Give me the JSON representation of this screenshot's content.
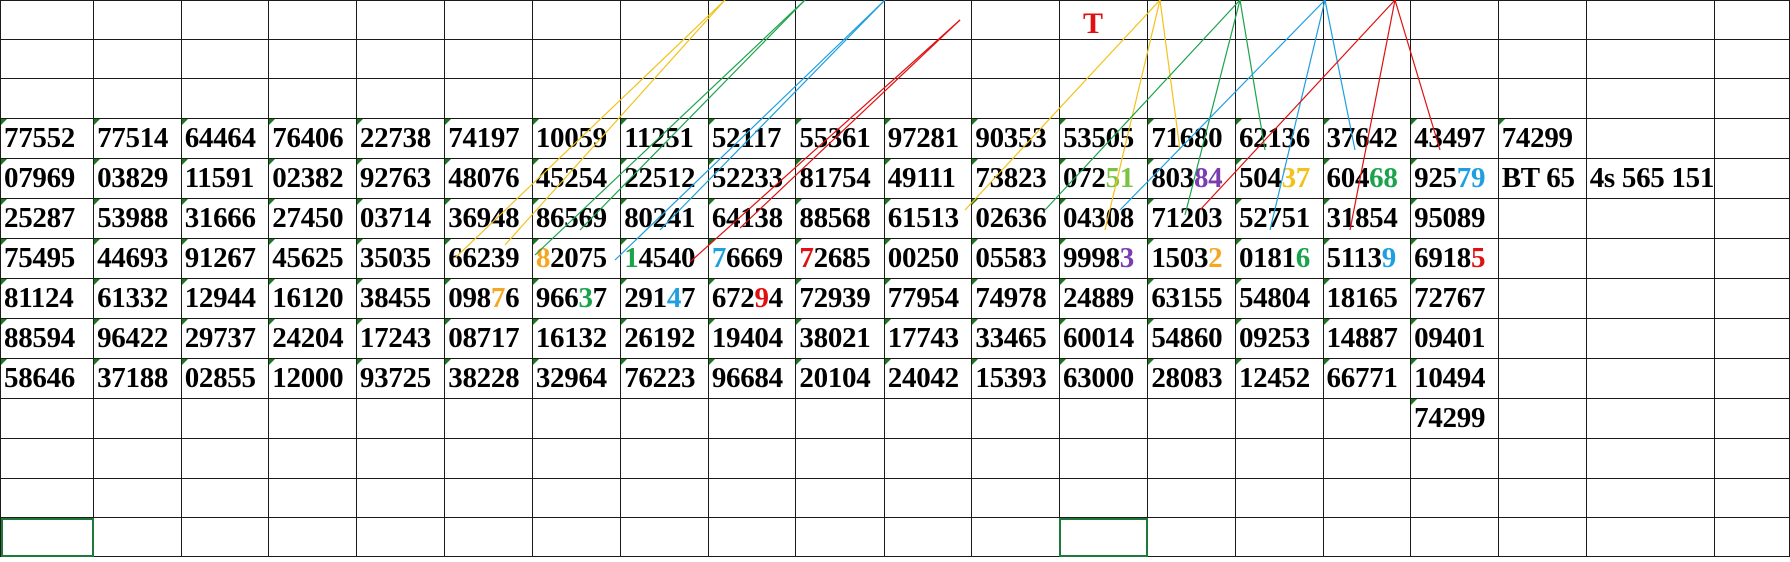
{
  "colors": {
    "red": "#e01010",
    "orange": "#f5a623",
    "green": "#1aa34a",
    "blue": "#1e9fe0",
    "purple": "#7a3db0",
    "lightgreen": "#7cc242",
    "yellow": "#f2c21b"
  },
  "annotations": {
    "t_label": "T"
  },
  "rows": [
    [
      {
        "t": ""
      },
      {
        "t": ""
      },
      {
        "t": ""
      },
      {
        "t": ""
      },
      {
        "t": ""
      },
      {
        "t": ""
      },
      {
        "t": ""
      },
      {
        "t": ""
      },
      {
        "t": ""
      },
      {
        "t": ""
      },
      {
        "t": ""
      },
      {
        "t": ""
      },
      {
        "t": ""
      },
      {
        "t": ""
      },
      {
        "t": ""
      },
      {
        "t": ""
      },
      {
        "t": ""
      },
      {
        "t": ""
      },
      {
        "t": ""
      },
      {
        "t": ""
      }
    ],
    [
      {
        "t": ""
      },
      {
        "t": ""
      },
      {
        "t": ""
      },
      {
        "t": ""
      },
      {
        "t": ""
      },
      {
        "t": ""
      },
      {
        "t": ""
      },
      {
        "t": ""
      },
      {
        "t": ""
      },
      {
        "t": ""
      },
      {
        "t": ""
      },
      {
        "t": ""
      },
      {
        "t": ""
      },
      {
        "t": ""
      },
      {
        "t": ""
      },
      {
        "t": ""
      },
      {
        "t": ""
      },
      {
        "t": ""
      },
      {
        "t": ""
      },
      {
        "t": ""
      }
    ],
    [
      {
        "t": ""
      },
      {
        "t": ""
      },
      {
        "t": ""
      },
      {
        "t": ""
      },
      {
        "t": ""
      },
      {
        "t": ""
      },
      {
        "t": ""
      },
      {
        "t": ""
      },
      {
        "t": ""
      },
      {
        "t": ""
      },
      {
        "t": ""
      },
      {
        "t": ""
      },
      {
        "t": ""
      },
      {
        "t": ""
      },
      {
        "t": ""
      },
      {
        "t": ""
      },
      {
        "t": ""
      },
      {
        "t": ""
      },
      {
        "t": ""
      },
      {
        "t": ""
      }
    ],
    [
      {
        "t": "77552"
      },
      {
        "t": "77514"
      },
      {
        "t": "64464"
      },
      {
        "t": "76406"
      },
      {
        "t": "22738"
      },
      {
        "t": "74197"
      },
      {
        "t": "10059"
      },
      {
        "t": "11251"
      },
      {
        "t": "52117"
      },
      {
        "t": "55361"
      },
      {
        "t": "97281"
      },
      {
        "t": "90353"
      },
      {
        "t": "53505"
      },
      {
        "t": "71680"
      },
      {
        "t": "62136"
      },
      {
        "t": "37642"
      },
      {
        "t": "43497"
      },
      {
        "t": "74299"
      },
      {
        "t": ""
      },
      {
        "t": ""
      }
    ],
    [
      {
        "t": "07969"
      },
      {
        "t": "03829"
      },
      {
        "t": "11591"
      },
      {
        "t": "02382"
      },
      {
        "t": "92763"
      },
      {
        "t": "48076"
      },
      {
        "t": "45254"
      },
      {
        "t": "22512"
      },
      {
        "t": "52233"
      },
      {
        "t": "81754"
      },
      {
        "t": "49111"
      },
      {
        "t": "73823"
      },
      {
        "t": "072",
        "h": "51",
        "c": "lightgreen"
      },
      {
        "t": "803",
        "h": "84",
        "c": "purple"
      },
      {
        "t": "504",
        "h": "37",
        "c": "yellow"
      },
      {
        "t": "604",
        "h": "68",
        "c": "green"
      },
      {
        "t": "925",
        "h": "79",
        "c": "blue"
      },
      {
        "t": "BT 65",
        "red": true
      },
      {
        "t": "4s 565 151",
        "red": true
      },
      {
        "t": ""
      }
    ],
    [
      {
        "t": "25287"
      },
      {
        "t": "53988"
      },
      {
        "t": "31666"
      },
      {
        "t": "27450"
      },
      {
        "t": "03714"
      },
      {
        "t": "36948"
      },
      {
        "t": "86569"
      },
      {
        "t": "80241"
      },
      {
        "t": "64138"
      },
      {
        "t": "88568"
      },
      {
        "t": "61513"
      },
      {
        "t": "02636"
      },
      {
        "t": "04308"
      },
      {
        "t": "71203"
      },
      {
        "t": "52751"
      },
      {
        "t": "31854"
      },
      {
        "t": "95089"
      },
      {
        "t": ""
      },
      {
        "t": ""
      },
      {
        "t": ""
      }
    ],
    [
      {
        "t": "75495"
      },
      {
        "t": "44693"
      },
      {
        "t": "91267"
      },
      {
        "t": "45625"
      },
      {
        "t": "35035"
      },
      {
        "t": "66239"
      },
      {
        "t": "",
        "h": "8",
        "c": "orange",
        "s": "2075"
      },
      {
        "t": "",
        "h": "1",
        "c": "green",
        "s": "4540"
      },
      {
        "t": "",
        "h": "7",
        "c": "blue",
        "s": "6669"
      },
      {
        "t": "",
        "h": "7",
        "c": "red",
        "s": "2685"
      },
      {
        "t": "00250"
      },
      {
        "t": "05583"
      },
      {
        "t": "9998",
        "h": "3",
        "c": "purple"
      },
      {
        "t": "1503",
        "h": "2",
        "c": "orange"
      },
      {
        "t": "0181",
        "h": "6",
        "c": "green"
      },
      {
        "t": "5113",
        "h": "9",
        "c": "blue"
      },
      {
        "t": "6918",
        "h": "5",
        "c": "red"
      },
      {
        "t": ""
      },
      {
        "t": ""
      },
      {
        "t": ""
      }
    ],
    [
      {
        "t": "81124"
      },
      {
        "t": "61332"
      },
      {
        "t": "12944"
      },
      {
        "t": "16120"
      },
      {
        "t": "38455"
      },
      {
        "t": "098",
        "h": "7",
        "c": "orange",
        "s": "6"
      },
      {
        "t": "966",
        "h": "3",
        "c": "green",
        "s": "7"
      },
      {
        "t": "291",
        "h": "4",
        "c": "blue",
        "s": "7"
      },
      {
        "t": "672",
        "h": "9",
        "c": "red",
        "s": "4"
      },
      {
        "t": "72939"
      },
      {
        "t": "77954"
      },
      {
        "t": "74978"
      },
      {
        "t": "24889"
      },
      {
        "t": "63155"
      },
      {
        "t": "54804"
      },
      {
        "t": "18165"
      },
      {
        "t": "72767"
      },
      {
        "t": ""
      },
      {
        "t": ""
      },
      {
        "t": ""
      }
    ],
    [
      {
        "t": "88594"
      },
      {
        "t": "96422"
      },
      {
        "t": "29737"
      },
      {
        "t": "24204"
      },
      {
        "t": "17243"
      },
      {
        "t": "08717"
      },
      {
        "t": "16132"
      },
      {
        "t": "26192"
      },
      {
        "t": "19404"
      },
      {
        "t": "38021"
      },
      {
        "t": "17743"
      },
      {
        "t": "33465"
      },
      {
        "t": "60014"
      },
      {
        "t": "54860"
      },
      {
        "t": "09253"
      },
      {
        "t": "14887"
      },
      {
        "t": "09401"
      },
      {
        "t": ""
      },
      {
        "t": ""
      },
      {
        "t": ""
      }
    ],
    [
      {
        "t": "58646"
      },
      {
        "t": "37188"
      },
      {
        "t": "02855"
      },
      {
        "t": "12000"
      },
      {
        "t": "93725"
      },
      {
        "t": "38228"
      },
      {
        "t": "32964"
      },
      {
        "t": "76223"
      },
      {
        "t": "96684"
      },
      {
        "t": "20104"
      },
      {
        "t": "24042"
      },
      {
        "t": "15393"
      },
      {
        "t": "63000"
      },
      {
        "t": "28083"
      },
      {
        "t": "12452"
      },
      {
        "t": "66771"
      },
      {
        "t": "10494"
      },
      {
        "t": ""
      },
      {
        "t": ""
      },
      {
        "t": ""
      }
    ],
    [
      {
        "t": ""
      },
      {
        "t": ""
      },
      {
        "t": ""
      },
      {
        "t": ""
      },
      {
        "t": ""
      },
      {
        "t": ""
      },
      {
        "t": ""
      },
      {
        "t": ""
      },
      {
        "t": ""
      },
      {
        "t": ""
      },
      {
        "t": ""
      },
      {
        "t": ""
      },
      {
        "t": ""
      },
      {
        "t": ""
      },
      {
        "t": ""
      },
      {
        "t": ""
      },
      {
        "t": "74299"
      },
      {
        "t": ""
      },
      {
        "t": ""
      },
      {
        "t": ""
      }
    ],
    [
      {
        "t": ""
      },
      {
        "t": ""
      },
      {
        "t": ""
      },
      {
        "t": ""
      },
      {
        "t": ""
      },
      {
        "t": ""
      },
      {
        "t": ""
      },
      {
        "t": ""
      },
      {
        "t": ""
      },
      {
        "t": ""
      },
      {
        "t": ""
      },
      {
        "t": ""
      },
      {
        "t": ""
      },
      {
        "t": ""
      },
      {
        "t": ""
      },
      {
        "t": ""
      },
      {
        "t": ""
      },
      {
        "t": ""
      },
      {
        "t": ""
      },
      {
        "t": ""
      }
    ],
    [
      {
        "t": ""
      },
      {
        "t": ""
      },
      {
        "t": ""
      },
      {
        "t": ""
      },
      {
        "t": ""
      },
      {
        "t": ""
      },
      {
        "t": ""
      },
      {
        "t": ""
      },
      {
        "t": ""
      },
      {
        "t": ""
      },
      {
        "t": ""
      },
      {
        "t": ""
      },
      {
        "t": ""
      },
      {
        "t": ""
      },
      {
        "t": ""
      },
      {
        "t": ""
      },
      {
        "t": ""
      },
      {
        "t": ""
      },
      {
        "t": ""
      },
      {
        "t": ""
      }
    ],
    [
      {
        "t": ""
      },
      {
        "t": ""
      },
      {
        "t": ""
      },
      {
        "t": ""
      },
      {
        "t": ""
      },
      {
        "t": ""
      },
      {
        "t": ""
      },
      {
        "t": ""
      },
      {
        "t": ""
      },
      {
        "t": ""
      },
      {
        "t": ""
      },
      {
        "t": ""
      },
      {
        "t": ""
      },
      {
        "t": ""
      },
      {
        "t": ""
      },
      {
        "t": ""
      },
      {
        "t": ""
      },
      {
        "t": ""
      },
      {
        "t": ""
      },
      {
        "t": ""
      }
    ]
  ]
}
